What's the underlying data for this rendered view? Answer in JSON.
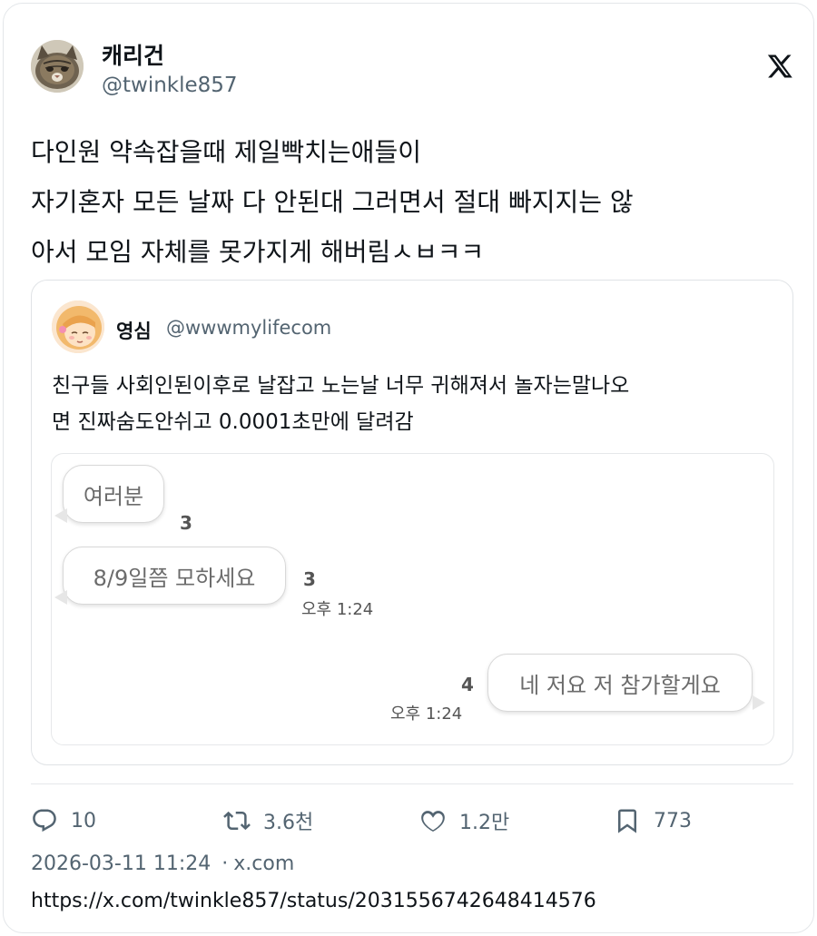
{
  "author": {
    "display_name": "캐리건",
    "handle": "@twinkle857"
  },
  "tweet": {
    "lines": [
      "다인원 약속잡을때 제일빡치는애들이",
      "자기혼자 모든 날짜 다 안된대 그러면서 절대 빠지지는 않",
      "아서 모임 자체를 못가지게 해버림ㅅㅂㅋㅋ"
    ]
  },
  "quote": {
    "display_name": "영심",
    "handle": "@wwwmylifecom",
    "lines": [
      "친구들 사회인된이후로 날잡고 노는날 너무 귀해져서 놀자는말나오",
      "면 진짜숨도안쉬고 0.0001초만에 달려감"
    ],
    "chat": {
      "messages": [
        {
          "text": "여러분",
          "count": "3",
          "time": ""
        },
        {
          "text": "8/9일쯤 모하세요",
          "count": "3",
          "time": "오후 1:24"
        },
        {
          "text": "네 저요 저 참가할게요",
          "count": "4",
          "time": "오후 1:24"
        }
      ]
    }
  },
  "actions": {
    "replies": "10",
    "retweets": "3.6천",
    "likes": "1.2만",
    "bookmarks": "773"
  },
  "meta": {
    "timestamp": "2026-03-11 11:24",
    "separator": "·",
    "source": "x.com",
    "url": "https://x.com/twinkle857/status/2031556742648414576"
  },
  "icons": {
    "brand": "x-logo-icon",
    "reply": "reply-icon",
    "retweet": "retweet-icon",
    "like": "heart-icon",
    "bookmark": "bookmark-icon"
  }
}
